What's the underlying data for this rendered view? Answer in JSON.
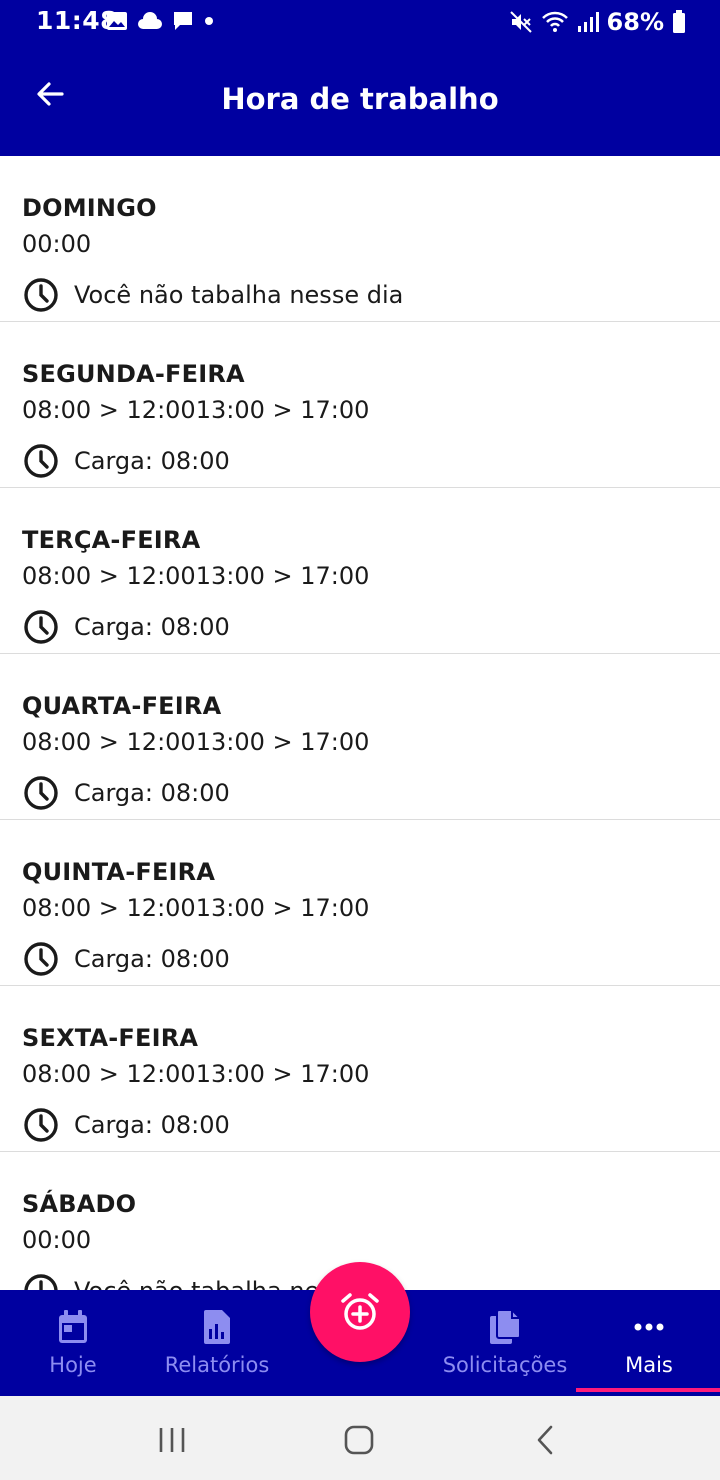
{
  "status_bar": {
    "time": "11:48",
    "battery": "68%",
    "left_icons": [
      "image-icon",
      "cloud-icon",
      "chat-icon",
      "dot-icon"
    ],
    "right_icons": [
      "mute-icon",
      "wifi-icon",
      "signal-icon",
      "battery-icon"
    ]
  },
  "app_bar": {
    "title": "Hora de trabalho",
    "back_icon": "arrow-left-icon"
  },
  "days": [
    {
      "name": "DOMINGO",
      "hours": "00:00",
      "detail": "Você não tabalha nesse dia"
    },
    {
      "name": "SEGUNDA-FEIRA",
      "hours": "08:00 > 12:0013:00 > 17:00",
      "detail": "Carga: 08:00"
    },
    {
      "name": "TERÇA-FEIRA",
      "hours": "08:00 > 12:0013:00 > 17:00",
      "detail": "Carga: 08:00"
    },
    {
      "name": "QUARTA-FEIRA",
      "hours": "08:00 > 12:0013:00 > 17:00",
      "detail": "Carga: 08:00"
    },
    {
      "name": "QUINTA-FEIRA",
      "hours": "08:00 > 12:0013:00 > 17:00",
      "detail": "Carga: 08:00"
    },
    {
      "name": "SEXTA-FEIRA",
      "hours": "08:00 > 12:0013:00 > 17:00",
      "detail": "Carga: 08:00"
    },
    {
      "name": "SÁBADO",
      "hours": "00:00",
      "detail": "Você não tabalha nesse dia"
    }
  ],
  "bottom_nav": {
    "items": [
      {
        "label": "Hoje",
        "icon": "calendar-icon"
      },
      {
        "label": "Relatórios",
        "icon": "report-icon"
      },
      {
        "label": "Solicitações",
        "icon": "documents-icon"
      },
      {
        "label": "Mais",
        "icon": "more-icon"
      }
    ],
    "active": "Mais",
    "fab_icon": "alarm-add-icon"
  },
  "colors": {
    "primary": "#0000a0",
    "accent": "#ff1066",
    "inactive_nav": "#8d8df0"
  }
}
